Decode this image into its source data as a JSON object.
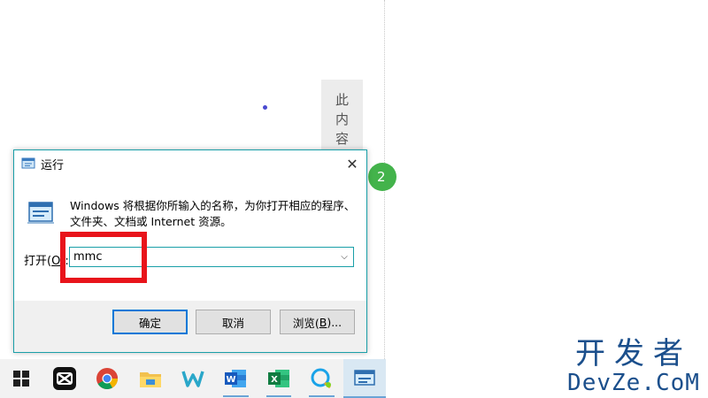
{
  "background_note": {
    "vertical_text": [
      "此",
      "内",
      "容"
    ],
    "badge_text": "2"
  },
  "run_dialog": {
    "title": "运行",
    "icon": "run-program-icon",
    "close_glyph": "✕",
    "description_line1": "Windows 将根据你所输入的名称，为你打开相应的程序、",
    "description_line2": "文件夹、文档或 Internet 资源。",
    "open_label": "打开(",
    "open_label_mnemonic": "O",
    "open_label_suffix": "):",
    "input_value": "mmc",
    "dropdown_glyph": "⌵",
    "buttons": {
      "ok": "确定",
      "cancel": "取消",
      "browse_prefix": "浏览(",
      "browse_mnemonic": "B",
      "browse_suffix": ")..."
    },
    "highlight_color": "#e8141b"
  },
  "taskbar": {
    "items": [
      {
        "name": "start-windows-icon"
      },
      {
        "name": "capcut-icon"
      },
      {
        "name": "chrome-icon"
      },
      {
        "name": "file-explorer-icon"
      },
      {
        "name": "wps-writer-icon"
      },
      {
        "name": "word-icon"
      },
      {
        "name": "excel-icon"
      },
      {
        "name": "chat-app-icon"
      },
      {
        "name": "run-dialog-taskbar-icon"
      }
    ]
  },
  "watermark": {
    "cn": "开发者",
    "en": "DevZe.CoM"
  },
  "colors": {
    "accent": "#1a9fa8",
    "default_button_border": "#0078d7",
    "watermark": "#1b4f8c"
  }
}
